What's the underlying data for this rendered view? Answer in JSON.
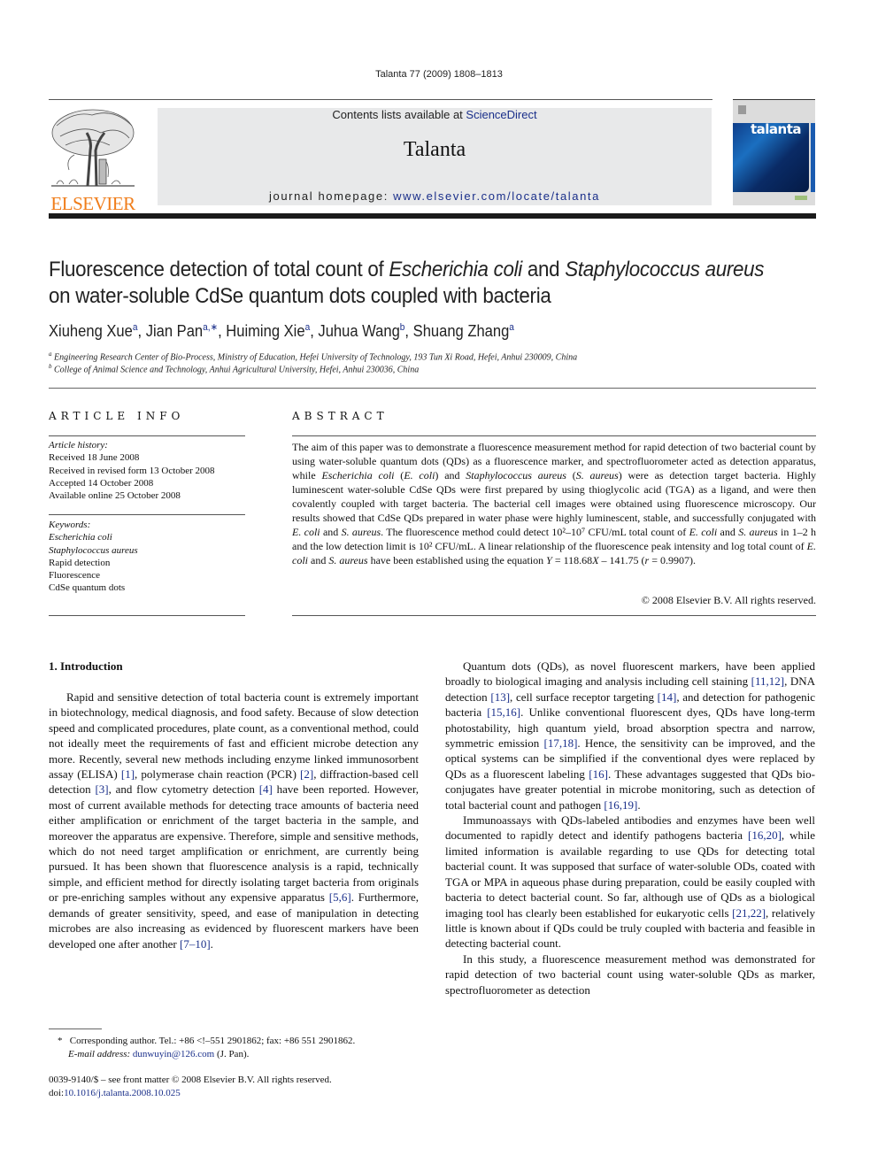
{
  "header": {
    "journal_ref": "Talanta 77 (2009) 1808–1813",
    "contents_prefix": "Contents lists available at ",
    "contents_link": "ScienceDirect",
    "journal_title": "Talanta",
    "homepage_prefix": "journal homepage: ",
    "homepage_link": "www.elsevier.com/locate/talanta",
    "publisher_logo_text": "ELSEVIER",
    "cover_title": "talanta"
  },
  "colors": {
    "link": "#1a2f8a",
    "elsevier_orange": "#f07d1a",
    "banner_bg": "#e8e9ea"
  },
  "article": {
    "title_1": "Fluorescence detection of total count of ",
    "title_it1": "Escherichia coli",
    "title_2": " and ",
    "title_it2": "Staphylococcus aureus",
    "title_3": "on water-soluble CdSe quantum dots coupled with bacteria",
    "authors": [
      {
        "name": "Xiuheng Xue",
        "sup": "a"
      },
      {
        "name": "Jian Pan",
        "sup": "a,∗"
      },
      {
        "name": "Huiming Xie",
        "sup": "a"
      },
      {
        "name": "Juhua Wang",
        "sup": "b"
      },
      {
        "name": "Shuang Zhang",
        "sup": "a"
      }
    ],
    "affiliations": [
      {
        "label": "a",
        "text": "Engineering Research Center of Bio-Process, Ministry of Education, Hefei University of Technology, 193 Tun Xi Road, Hefei, Anhui 230009, China"
      },
      {
        "label": "b",
        "text": "College of Animal Science and Technology, Anhui Agricultural University, Hefei, Anhui 230036, China"
      }
    ]
  },
  "article_info": {
    "heading": "ARTICLE INFO",
    "history_label": "Article history:",
    "history": [
      "Received 18 June 2008",
      "Received in revised form 13 October 2008",
      "Accepted 14 October 2008",
      "Available online 25 October 2008"
    ],
    "keywords_label": "Keywords:",
    "keywords": [
      {
        "text": "Escherichia coli",
        "italic": true
      },
      {
        "text": "Staphylococcus aureus",
        "italic": true
      },
      {
        "text": "Rapid detection",
        "italic": false
      },
      {
        "text": "Fluorescence",
        "italic": false
      },
      {
        "text": "CdSe quantum dots",
        "italic": false
      }
    ]
  },
  "abstract": {
    "heading": "ABSTRACT",
    "segments": [
      {
        "t": "The aim of this paper was to demonstrate a fluorescence measurement method for rapid detection of two bacterial count by using water-soluble quantum dots (QDs) as a fluorescence marker, and spectrofluorometer acted as detection apparatus, while "
      },
      {
        "t": "Escherichia coli",
        "i": true
      },
      {
        "t": " ("
      },
      {
        "t": "E. coli",
        "i": true
      },
      {
        "t": ") and "
      },
      {
        "t": "Staphylococcus aureus",
        "i": true
      },
      {
        "t": " ("
      },
      {
        "t": "S. aureus",
        "i": true
      },
      {
        "t": ") were as detection target bacteria. Highly luminescent water-soluble CdSe QDs were first prepared by using thioglycolic acid (TGA) as a ligand, and were then covalently coupled with target bacteria. The bacterial cell images were obtained using fluorescence microscopy. Our results showed that CdSe QDs prepared in water phase were highly luminescent, stable, and successfully conjugated with "
      },
      {
        "t": "E. coli",
        "i": true
      },
      {
        "t": " and "
      },
      {
        "t": "S. aureus",
        "i": true
      },
      {
        "t": ". The fluorescence method could detect 10²–10⁷ CFU/mL total count of "
      },
      {
        "t": "E. coli",
        "i": true
      },
      {
        "t": " and "
      },
      {
        "t": "S. aureus",
        "i": true
      },
      {
        "t": " in 1–2 h and the low detection limit is 10² CFU/mL. A linear relationship of the fluorescence peak intensity and log total count of "
      },
      {
        "t": "E. coli",
        "i": true
      },
      {
        "t": " and "
      },
      {
        "t": "S. aureus",
        "i": true
      },
      {
        "t": " have been established using the equation "
      },
      {
        "t": "Y",
        "i": true
      },
      {
        "t": " = 118.68"
      },
      {
        "t": "X",
        "i": true
      },
      {
        "t": " – 141.75 ("
      },
      {
        "t": "r",
        "i": true
      },
      {
        "t": " = 0.9907)."
      }
    ],
    "copyright": "© 2008 Elsevier B.V. All rights reserved."
  },
  "introduction": {
    "heading": "1.  Introduction",
    "left_paragraphs": [
      [
        {
          "t": "Rapid and sensitive detection of total bacteria count is extremely important in biotechnology, medical diagnosis, and food safety. Because of slow detection speed and complicated procedures, plate count, as a conventional method, could not ideally meet the requirements of fast and efficient microbe detection any more. Recently, several new methods including enzyme linked immunosorbent assay (ELISA) "
        },
        {
          "t": "[1]",
          "l": true
        },
        {
          "t": ", polymerase chain reaction (PCR) "
        },
        {
          "t": "[2]",
          "l": true
        },
        {
          "t": ", diffraction-based cell detection "
        },
        {
          "t": "[3]",
          "l": true
        },
        {
          "t": ", and flow cytometry detection "
        },
        {
          "t": "[4]",
          "l": true
        },
        {
          "t": " have been reported. However, most of current available methods for detecting trace amounts of bacteria need either amplification or enrichment of the target bacteria in the sample, and moreover the apparatus are expensive. Therefore, simple and sensitive methods, which do not need target amplification or enrichment, are currently being pursued. It has been shown that fluorescence analysis is a rapid, technically simple, and efficient method for directly isolating target bacteria from originals or pre-enriching samples without any expensive apparatus "
        },
        {
          "t": "[5,6]",
          "l": true
        },
        {
          "t": ". Furthermore, demands of greater sensitivity, speed, and ease of manipulation in detecting microbes are also increasing as evidenced by fluorescent markers have been developed one after another "
        },
        {
          "t": "[7–10]",
          "l": true
        },
        {
          "t": "."
        }
      ]
    ],
    "right_paragraphs": [
      [
        {
          "t": "Quantum dots (QDs), as novel fluorescent markers, have been applied broadly to biological imaging and analysis including cell staining "
        },
        {
          "t": "[11,12]",
          "l": true
        },
        {
          "t": ", DNA detection "
        },
        {
          "t": "[13]",
          "l": true
        },
        {
          "t": ", cell surface receptor targeting "
        },
        {
          "t": "[14]",
          "l": true
        },
        {
          "t": ", and detection for pathogenic bacteria "
        },
        {
          "t": "[15,16]",
          "l": true
        },
        {
          "t": ". Unlike conventional fluorescent dyes, QDs have long-term photostability, high quantum yield, broad absorption spectra and narrow, symmetric emission "
        },
        {
          "t": "[17,18]",
          "l": true
        },
        {
          "t": ". Hence, the sensitivity can be improved, and the optical systems can be simplified if the conventional dyes were replaced by QDs as a fluorescent labeling "
        },
        {
          "t": "[16]",
          "l": true
        },
        {
          "t": ". These advantages suggested that QDs bio-conjugates have greater potential in microbe monitoring, such as detection of total bacterial count and pathogen "
        },
        {
          "t": "[16,19]",
          "l": true
        },
        {
          "t": "."
        }
      ],
      [
        {
          "t": "Immunoassays with QDs-labeled antibodies and enzymes have been well documented to rapidly detect and identify pathogens bacteria "
        },
        {
          "t": "[16,20]",
          "l": true
        },
        {
          "t": ", while limited information is available regarding to use QDs for detecting total bacterial count. It was supposed that surface of water-soluble ODs, coated with TGA or MPA in aqueous phase during preparation, could be easily coupled with bacteria to detect bacterial count. So far, although use of QDs as a biological imaging tool has clearly been established for eukaryotic cells "
        },
        {
          "t": "[21,22]",
          "l": true
        },
        {
          "t": ", relatively little is known about if QDs could be truly coupled with bacteria and feasible in detecting bacterial count."
        }
      ],
      [
        {
          "t": "In this study, a fluorescence measurement method was demonstrated for rapid detection of two bacterial count using water-soluble QDs as marker, spectrofluorometer as detection"
        }
      ]
    ]
  },
  "footnote": {
    "marker": "*",
    "corresponding": "Corresponding author. Tel.: +86 <!–551 2901862; fax: +86 551 2901862.",
    "email_label": "E-mail address: ",
    "email": "dunwuyin@126.com",
    "email_suffix": " (J. Pan)."
  },
  "front_matter": {
    "issn_line": "0039-9140/$ – see front matter © 2008 Elsevier B.V. All rights reserved.",
    "doi_prefix": "doi:",
    "doi": "10.1016/j.talanta.2008.10.025"
  }
}
